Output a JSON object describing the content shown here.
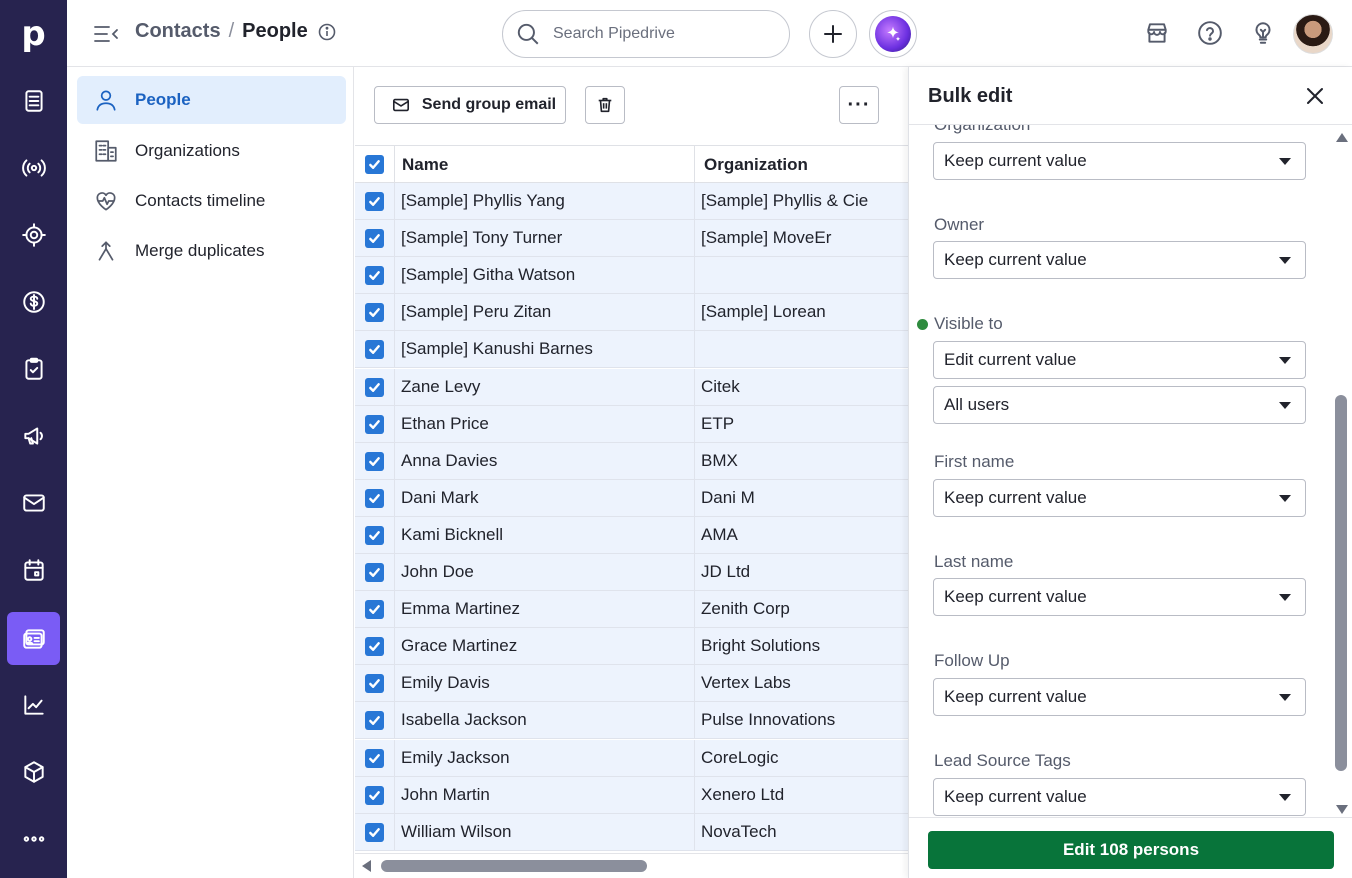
{
  "app": {
    "logo": "p"
  },
  "rail": {
    "items": [
      {
        "icon": "leads-icon",
        "active": false
      },
      {
        "icon": "broadcast-icon",
        "active": false
      },
      {
        "icon": "target-icon",
        "active": false
      },
      {
        "icon": "dollar-icon",
        "active": false
      },
      {
        "icon": "clipboard-check-icon",
        "active": false
      },
      {
        "icon": "megaphone-icon",
        "active": false
      },
      {
        "icon": "mail-icon",
        "active": false
      },
      {
        "icon": "calendar-icon",
        "active": false
      },
      {
        "icon": "contacts-card-icon",
        "active": true
      },
      {
        "icon": "chart-line-icon",
        "active": false
      },
      {
        "icon": "box-icon",
        "active": false
      },
      {
        "icon": "more-dots-icon",
        "active": false
      }
    ]
  },
  "header": {
    "breadcrumb_root": "Contacts",
    "breadcrumb_sep": "/",
    "breadcrumb_current": "People",
    "search_placeholder": "Search Pipedrive"
  },
  "sidebar": {
    "items": [
      {
        "label": "People",
        "icon": "person-icon",
        "active": true
      },
      {
        "label": "Organizations",
        "icon": "building-icon",
        "active": false
      },
      {
        "label": "Contacts timeline",
        "icon": "heart-pulse-icon",
        "active": false
      },
      {
        "label": "Merge duplicates",
        "icon": "merge-icon",
        "active": false
      }
    ]
  },
  "toolbar": {
    "send_email_label": "Send group email",
    "more_label": "···"
  },
  "table": {
    "columns": [
      "Name",
      "Organization"
    ],
    "rows": [
      {
        "name": "[Sample] Phyllis Yang",
        "org": "[Sample] Phyllis & Cie"
      },
      {
        "name": "[Sample] Tony Turner",
        "org": "[Sample] MoveEr"
      },
      {
        "name": "[Sample] Githa Watson",
        "org": ""
      },
      {
        "name": "[Sample] Peru Zitan",
        "org": "[Sample] Lorean"
      },
      {
        "name": "[Sample] Kanushi Barnes",
        "org": ""
      },
      {
        "name": "Zane Levy",
        "org": "Citek"
      },
      {
        "name": "Ethan Price",
        "org": "ETP"
      },
      {
        "name": "Anna Davies",
        "org": "BMX"
      },
      {
        "name": "Dani Mark",
        "org": "Dani M"
      },
      {
        "name": "Kami Bicknell",
        "org": "AMA"
      },
      {
        "name": "John Doe",
        "org": "JD Ltd"
      },
      {
        "name": "Emma Martinez",
        "org": "Zenith Corp"
      },
      {
        "name": "Grace Martinez",
        "org": "Bright Solutions"
      },
      {
        "name": "Emily Davis",
        "org": "Vertex Labs"
      },
      {
        "name": "Isabella Jackson",
        "org": "Pulse Innovations"
      },
      {
        "name": "Emily Jackson",
        "org": "CoreLogic"
      },
      {
        "name": "John Martin",
        "org": "Xenero Ltd"
      },
      {
        "name": "William Wilson",
        "org": "NovaTech"
      }
    ]
  },
  "bulk_edit": {
    "title": "Bulk edit",
    "fields": [
      {
        "label": "Organization",
        "value": "Keep current value",
        "partially_hidden": true
      },
      {
        "label": "Owner",
        "value": "Keep current value"
      },
      {
        "label": "Visible to",
        "value": "Edit current value",
        "extra_value": "All users",
        "changed": true
      },
      {
        "label": "First name",
        "value": "Keep current value"
      },
      {
        "label": "Last name",
        "value": "Keep current value"
      },
      {
        "label": "Follow Up",
        "value": "Keep current value"
      },
      {
        "label": "Lead Source Tags",
        "value": "Keep current value"
      }
    ],
    "submit_label": "Edit 108 persons",
    "accent_color": "#08743a"
  },
  "colors": {
    "rail_bg": "#27234f",
    "rail_active": "#7a5cf5",
    "selected_row": "#edf3fd",
    "checkbox": "#2877d6",
    "link_active": "#1b62c1"
  }
}
